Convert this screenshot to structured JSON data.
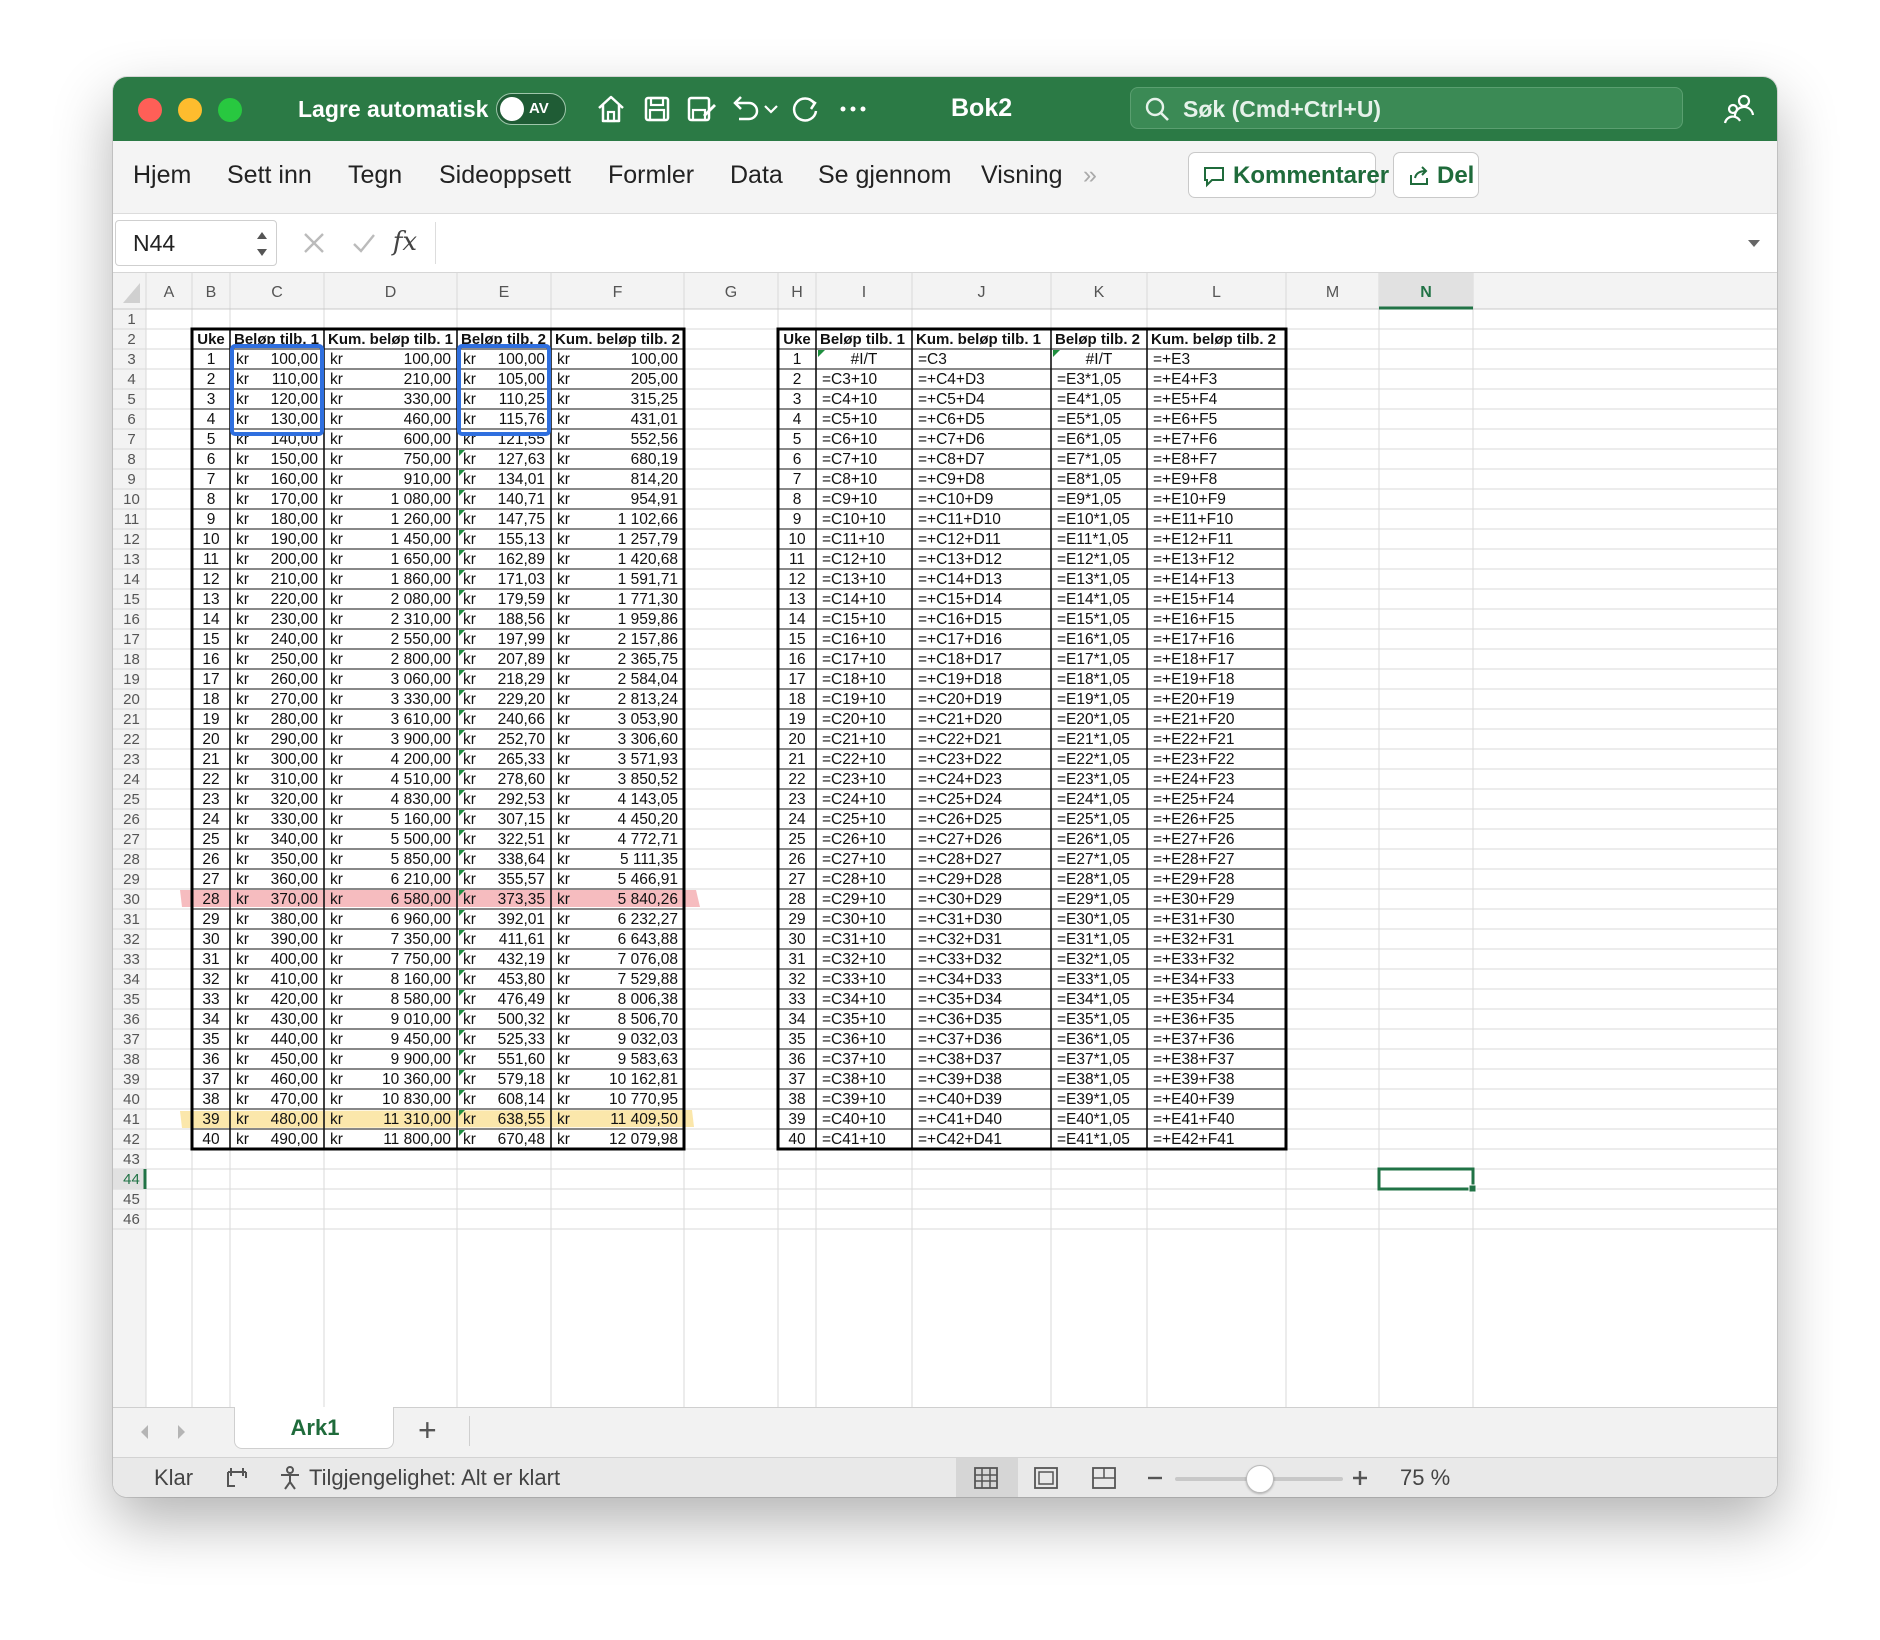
{
  "titlebar": {
    "autosave_label": "Lagre automatisk",
    "autosave_state": "AV",
    "document_title": "Bok2",
    "search_placeholder": "Søk (Cmd+Ctrl+U)"
  },
  "ribbon": {
    "tabs": [
      "Hjem",
      "Sett inn",
      "Tegn",
      "Sideoppsett",
      "Formler",
      "Data",
      "Se gjennom",
      "Visning"
    ],
    "more": "»",
    "comments_label": "Kommentarer",
    "share_label": "Del"
  },
  "formula_bar": {
    "name_box": "N44",
    "fx": "fx",
    "formula": ""
  },
  "grid": {
    "columns": [
      "A",
      "B",
      "C",
      "D",
      "E",
      "F",
      "G",
      "H",
      "I",
      "J",
      "K",
      "L",
      "M",
      "N"
    ],
    "selected_column": "N",
    "row_numbers": [
      1,
      2,
      3,
      4,
      5,
      6,
      7,
      8,
      9,
      10,
      11,
      12,
      13,
      14,
      15,
      16,
      17,
      18,
      19,
      20,
      21,
      22,
      23,
      24,
      25,
      26,
      27,
      28,
      29,
      30,
      31,
      32,
      33,
      34,
      35,
      36,
      37,
      38,
      39,
      40,
      41,
      42,
      43,
      44,
      45,
      46
    ],
    "selected_row": 44,
    "highlight_red_row": 30,
    "highlight_yellow_row": 41,
    "value_table": {
      "headers": [
        "Uke",
        "Beløp tilb. 1",
        "Kum. beløp tilb. 1",
        "Beløp tilb. 2",
        "Kum. beløp tilb. 2"
      ],
      "currency": "kr",
      "rows": [
        [
          "1",
          "100,00",
          "100,00",
          "100,00",
          "100,00"
        ],
        [
          "2",
          "110,00",
          "210,00",
          "105,00",
          "205,00"
        ],
        [
          "3",
          "120,00",
          "330,00",
          "110,25",
          "315,25"
        ],
        [
          "4",
          "130,00",
          "460,00",
          "115,76",
          "431,01"
        ],
        [
          "5",
          "140,00",
          "600,00",
          "121,55",
          "552,56"
        ],
        [
          "6",
          "150,00",
          "750,00",
          "127,63",
          "680,19"
        ],
        [
          "7",
          "160,00",
          "910,00",
          "134,01",
          "814,20"
        ],
        [
          "8",
          "170,00",
          "1 080,00",
          "140,71",
          "954,91"
        ],
        [
          "9",
          "180,00",
          "1 260,00",
          "147,75",
          "1 102,66"
        ],
        [
          "10",
          "190,00",
          "1 450,00",
          "155,13",
          "1 257,79"
        ],
        [
          "11",
          "200,00",
          "1 650,00",
          "162,89",
          "1 420,68"
        ],
        [
          "12",
          "210,00",
          "1 860,00",
          "171,03",
          "1 591,71"
        ],
        [
          "13",
          "220,00",
          "2 080,00",
          "179,59",
          "1 771,30"
        ],
        [
          "14",
          "230,00",
          "2 310,00",
          "188,56",
          "1 959,86"
        ],
        [
          "15",
          "240,00",
          "2 550,00",
          "197,99",
          "2 157,86"
        ],
        [
          "16",
          "250,00",
          "2 800,00",
          "207,89",
          "2 365,75"
        ],
        [
          "17",
          "260,00",
          "3 060,00",
          "218,29",
          "2 584,04"
        ],
        [
          "18",
          "270,00",
          "3 330,00",
          "229,20",
          "2 813,24"
        ],
        [
          "19",
          "280,00",
          "3 610,00",
          "240,66",
          "3 053,90"
        ],
        [
          "20",
          "290,00",
          "3 900,00",
          "252,70",
          "3 306,60"
        ],
        [
          "21",
          "300,00",
          "4 200,00",
          "265,33",
          "3 571,93"
        ],
        [
          "22",
          "310,00",
          "4 510,00",
          "278,60",
          "3 850,52"
        ],
        [
          "23",
          "320,00",
          "4 830,00",
          "292,53",
          "4 143,05"
        ],
        [
          "24",
          "330,00",
          "5 160,00",
          "307,15",
          "4 450,20"
        ],
        [
          "25",
          "340,00",
          "5 500,00",
          "322,51",
          "4 772,71"
        ],
        [
          "26",
          "350,00",
          "5 850,00",
          "338,64",
          "5 111,35"
        ],
        [
          "27",
          "360,00",
          "6 210,00",
          "355,57",
          "5 466,91"
        ],
        [
          "28",
          "370,00",
          "6 580,00",
          "373,35",
          "5 840,26"
        ],
        [
          "29",
          "380,00",
          "6 960,00",
          "392,01",
          "6 232,27"
        ],
        [
          "30",
          "390,00",
          "7 350,00",
          "411,61",
          "6 643,88"
        ],
        [
          "31",
          "400,00",
          "7 750,00",
          "432,19",
          "7 076,08"
        ],
        [
          "32",
          "410,00",
          "8 160,00",
          "453,80",
          "7 529,88"
        ],
        [
          "33",
          "420,00",
          "8 580,00",
          "476,49",
          "8 006,38"
        ],
        [
          "34",
          "430,00",
          "9 010,00",
          "500,32",
          "8 506,70"
        ],
        [
          "35",
          "440,00",
          "9 450,00",
          "525,33",
          "9 032,03"
        ],
        [
          "36",
          "450,00",
          "9 900,00",
          "551,60",
          "9 583,63"
        ],
        [
          "37",
          "460,00",
          "10 360,00",
          "579,18",
          "10 162,81"
        ],
        [
          "38",
          "470,00",
          "10 830,00",
          "608,14",
          "10 770,95"
        ],
        [
          "39",
          "480,00",
          "11 310,00",
          "638,55",
          "11 409,50"
        ],
        [
          "40",
          "490,00",
          "11 800,00",
          "670,48",
          "12 079,98"
        ]
      ]
    },
    "formula_table": {
      "headers": [
        "Uke",
        "Beløp tilb. 1",
        "Kum. beløp tilb. 1",
        "Beløp tilb. 2",
        "Kum. beløp tilb. 2"
      ],
      "rows": [
        [
          "1",
          "#I/T",
          "=C3",
          "#I/T",
          "=+E3"
        ],
        [
          "2",
          "=C3+10",
          "=+C4+D3",
          "=E3*1,05",
          "=+E4+F3"
        ],
        [
          "3",
          "=C4+10",
          "=+C5+D4",
          "=E4*1,05",
          "=+E5+F4"
        ],
        [
          "4",
          "=C5+10",
          "=+C6+D5",
          "=E5*1,05",
          "=+E6+F5"
        ],
        [
          "5",
          "=C6+10",
          "=+C7+D6",
          "=E6*1,05",
          "=+E7+F6"
        ],
        [
          "6",
          "=C7+10",
          "=+C8+D7",
          "=E7*1,05",
          "=+E8+F7"
        ],
        [
          "7",
          "=C8+10",
          "=+C9+D8",
          "=E8*1,05",
          "=+E9+F8"
        ],
        [
          "8",
          "=C9+10",
          "=+C10+D9",
          "=E9*1,05",
          "=+E10+F9"
        ],
        [
          "9",
          "=C10+10",
          "=+C11+D10",
          "=E10*1,05",
          "=+E11+F10"
        ],
        [
          "10",
          "=C11+10",
          "=+C12+D11",
          "=E11*1,05",
          "=+E12+F11"
        ],
        [
          "11",
          "=C12+10",
          "=+C13+D12",
          "=E12*1,05",
          "=+E13+F12"
        ],
        [
          "12",
          "=C13+10",
          "=+C14+D13",
          "=E13*1,05",
          "=+E14+F13"
        ],
        [
          "13",
          "=C14+10",
          "=+C15+D14",
          "=E14*1,05",
          "=+E15+F14"
        ],
        [
          "14",
          "=C15+10",
          "=+C16+D15",
          "=E15*1,05",
          "=+E16+F15"
        ],
        [
          "15",
          "=C16+10",
          "=+C17+D16",
          "=E16*1,05",
          "=+E17+F16"
        ],
        [
          "16",
          "=C17+10",
          "=+C18+D17",
          "=E17*1,05",
          "=+E18+F17"
        ],
        [
          "17",
          "=C18+10",
          "=+C19+D18",
          "=E18*1,05",
          "=+E19+F18"
        ],
        [
          "18",
          "=C19+10",
          "=+C20+D19",
          "=E19*1,05",
          "=+E20+F19"
        ],
        [
          "19",
          "=C20+10",
          "=+C21+D20",
          "=E20*1,05",
          "=+E21+F20"
        ],
        [
          "20",
          "=C21+10",
          "=+C22+D21",
          "=E21*1,05",
          "=+E22+F21"
        ],
        [
          "21",
          "=C22+10",
          "=+C23+D22",
          "=E22*1,05",
          "=+E23+F22"
        ],
        [
          "22",
          "=C23+10",
          "=+C24+D23",
          "=E23*1,05",
          "=+E24+F23"
        ],
        [
          "23",
          "=C24+10",
          "=+C25+D24",
          "=E24*1,05",
          "=+E25+F24"
        ],
        [
          "24",
          "=C25+10",
          "=+C26+D25",
          "=E25*1,05",
          "=+E26+F25"
        ],
        [
          "25",
          "=C26+10",
          "=+C27+D26",
          "=E26*1,05",
          "=+E27+F26"
        ],
        [
          "26",
          "=C27+10",
          "=+C28+D27",
          "=E27*1,05",
          "=+E28+F27"
        ],
        [
          "27",
          "=C28+10",
          "=+C29+D28",
          "=E28*1,05",
          "=+E29+F28"
        ],
        [
          "28",
          "=C29+10",
          "=+C30+D29",
          "=E29*1,05",
          "=+E30+F29"
        ],
        [
          "29",
          "=C30+10",
          "=+C31+D30",
          "=E30*1,05",
          "=+E31+F30"
        ],
        [
          "30",
          "=C31+10",
          "=+C32+D31",
          "=E31*1,05",
          "=+E32+F31"
        ],
        [
          "31",
          "=C32+10",
          "=+C33+D32",
          "=E32*1,05",
          "=+E33+F32"
        ],
        [
          "32",
          "=C33+10",
          "=+C34+D33",
          "=E33*1,05",
          "=+E34+F33"
        ],
        [
          "33",
          "=C34+10",
          "=+C35+D34",
          "=E34*1,05",
          "=+E35+F34"
        ],
        [
          "34",
          "=C35+10",
          "=+C36+D35",
          "=E35*1,05",
          "=+E36+F35"
        ],
        [
          "35",
          "=C36+10",
          "=+C37+D36",
          "=E36*1,05",
          "=+E37+F36"
        ],
        [
          "36",
          "=C37+10",
          "=+C38+D37",
          "=E37*1,05",
          "=+E38+F37"
        ],
        [
          "37",
          "=C38+10",
          "=+C39+D38",
          "=E38*1,05",
          "=+E39+F38"
        ],
        [
          "38",
          "=C39+10",
          "=+C40+D39",
          "=E39*1,05",
          "=+E40+F39"
        ],
        [
          "39",
          "=C40+10",
          "=+C41+D40",
          "=E40*1,05",
          "=+E41+F40"
        ],
        [
          "40",
          "=C41+10",
          "=+C42+D41",
          "=E41*1,05",
          "=+E42+F41"
        ]
      ]
    }
  },
  "sheets": {
    "active": "Ark1",
    "add": "+"
  },
  "status": {
    "ready": "Klar",
    "accessibility": "Tilgjengelighet: Alt er klart",
    "zoom": "75 %",
    "zoom_fraction": 0.5
  },
  "colors": {
    "excel_green": "#2b7a45",
    "brand_text_green": "#1f6b3b",
    "selection_blue": "#2f6fdf",
    "highlight_red": "#f4b0b4",
    "highlight_yellow": "#fbe4a2",
    "selected_cell_border": "#217346"
  }
}
